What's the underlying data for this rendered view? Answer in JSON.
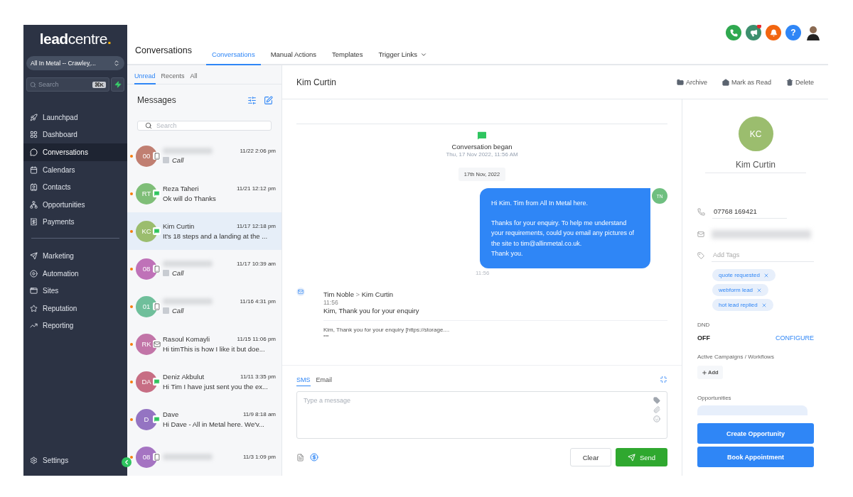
{
  "logo": {
    "main": "lead",
    "rest": "centre",
    "dot": "."
  },
  "account": "All In Metal -- Crawley,...",
  "search": {
    "placeholder": "Search",
    "shortcut": "⌘K"
  },
  "nav_primary": [
    {
      "label": "Launchpad",
      "selected": false
    },
    {
      "label": "Dashboard",
      "selected": false
    },
    {
      "label": "Conversations",
      "selected": true
    },
    {
      "label": "Calendars",
      "selected": false
    },
    {
      "label": "Contacts",
      "selected": false
    },
    {
      "label": "Opportunities",
      "selected": false
    },
    {
      "label": "Payments",
      "selected": false
    }
  ],
  "nav_secondary": [
    {
      "label": "Marketing",
      "selected": false
    },
    {
      "label": "Automation",
      "selected": false
    },
    {
      "label": "Sites",
      "selected": false
    },
    {
      "label": "Reputation",
      "selected": false
    },
    {
      "label": "Reporting",
      "selected": false
    }
  ],
  "settings": "Settings",
  "header": {
    "title": "Conversations",
    "tabs": [
      {
        "label": "Conversations",
        "selected": true,
        "dropdown": false
      },
      {
        "label": "Manual Actions",
        "selected": false,
        "dropdown": false
      },
      {
        "label": "Templates",
        "selected": false,
        "dropdown": false
      },
      {
        "label": "Trigger Links",
        "selected": false,
        "dropdown": true
      }
    ]
  },
  "top_icons": [
    {
      "kind": "phone",
      "color": "#2fa84f",
      "badge": false
    },
    {
      "kind": "megaphone",
      "color": "#3d8f6e",
      "badge": true
    },
    {
      "kind": "bell",
      "color": "#f2650f",
      "badge": false
    },
    {
      "kind": "help",
      "color": "#2f86f6",
      "badge": false,
      "label": "?"
    },
    {
      "kind": "avatar",
      "color": "#ffffff",
      "badge": false
    }
  ],
  "filters": [
    {
      "label": "Unread",
      "selected": true
    },
    {
      "label": "Recents",
      "selected": false
    },
    {
      "label": "All",
      "selected": false
    }
  ],
  "messages_title": "Messages",
  "list_search": {
    "placeholder": "Search"
  },
  "conversations": [
    {
      "initials": "00",
      "color": "#c07f72",
      "blurred": true,
      "time": "11/22 2:06 pm",
      "kind": "call",
      "preview": "Call",
      "unread": true,
      "selected": false
    },
    {
      "initials": "RT",
      "color": "#7fbe78",
      "blurred": false,
      "name": "Reza Taheri",
      "time": "11/21 12:12 pm",
      "kind": "sms",
      "preview": "Ok will do Thanks",
      "unread": true,
      "selected": false
    },
    {
      "initials": "KC",
      "color": "#9bbd6e",
      "blurred": false,
      "name": "Kim Curtin",
      "time": "11/17 12:18 pm",
      "kind": "sms",
      "preview": "It's 18 steps and a landing at the ...",
      "unread": true,
      "selected": true
    },
    {
      "initials": "08",
      "color": "#bf72b8",
      "blurred": true,
      "time": "11/17 10:39 am",
      "kind": "call",
      "preview": "Call",
      "unread": true,
      "selected": false
    },
    {
      "initials": "01",
      "color": "#6fbf9b",
      "blurred": true,
      "time": "11/16 4:31 pm",
      "kind": "call",
      "preview": "Call",
      "unread": true,
      "selected": false
    },
    {
      "initials": "RK",
      "color": "#c275a8",
      "blurred": false,
      "name": "Rasoul Komayli",
      "time": "11/15 11:06 pm",
      "kind": "email",
      "preview": "Hi timThis is how I like it but doe...",
      "unread": true,
      "selected": false
    },
    {
      "initials": "DA",
      "color": "#c76e84",
      "blurred": false,
      "name": "Deniz Akbulut",
      "time": "11/11 3:35 pm",
      "kind": "sms",
      "preview": "Hi Tim I have just sent you the ex...",
      "unread": true,
      "selected": false
    },
    {
      "initials": "D",
      "color": "#9474c2",
      "blurred": false,
      "name": "Dave",
      "time": "11/9 8:18 am",
      "kind": "sms",
      "preview": "Hi Dave - All in Metal here. We'v...",
      "unread": true,
      "selected": false
    },
    {
      "initials": "08",
      "color": "#a574c2",
      "blurred": true,
      "time": "11/3 1:09 pm",
      "kind": "call",
      "unread": true,
      "selected": false
    }
  ],
  "chat": {
    "contact": "Kim Curtin",
    "actions": [
      "Archive",
      "Mark as Read",
      "Delete"
    ],
    "began": {
      "title": "Conversation began",
      "date": "Thu, 17 Nov 2022, 11:56 AM"
    },
    "date_chip": "17th Nov, 2022",
    "outbound": {
      "paragraphs": [
        [
          "Hi Kim. Tim from All In Metal here."
        ],
        [
          "Thanks for your enquiry. To help me understand your requirements, could you email any pictures of the site to tim@allinmetal.co.uk.",
          "Thank you."
        ]
      ],
      "initials": "TN",
      "time": "11:56"
    },
    "email": {
      "from": "Tim Noble",
      "separator": ">",
      "to": "Kim Curtin",
      "time": "11:56",
      "subject": "Kim, Thank you for your enquiry",
      "body": "Kim, Thank you for your enquiry [https://storage....",
      "more": "•••"
    },
    "composer": {
      "tabs": [
        {
          "label": "SMS",
          "selected": true
        },
        {
          "label": "Email",
          "selected": false
        }
      ],
      "placeholder": "Type a message",
      "clear": "Clear",
      "send": "Send"
    }
  },
  "contact": {
    "initials": "KC",
    "color": "#9bbd6e",
    "name": "Kim Curtin",
    "phone": "07768 169421",
    "email_blurred": true,
    "tags_placeholder": "Add Tags",
    "tags": [
      "quote requested",
      "webform lead",
      "hot lead replied"
    ],
    "dnd_label": "DND",
    "dnd_value": "OFF",
    "configure": "CONFIGURE",
    "campaigns_label": "Active Campaigns / Workflows",
    "add": "Add",
    "opportunities_label": "Opportunities",
    "buttons": [
      "Create Opportunity",
      "Book Appointment"
    ]
  }
}
